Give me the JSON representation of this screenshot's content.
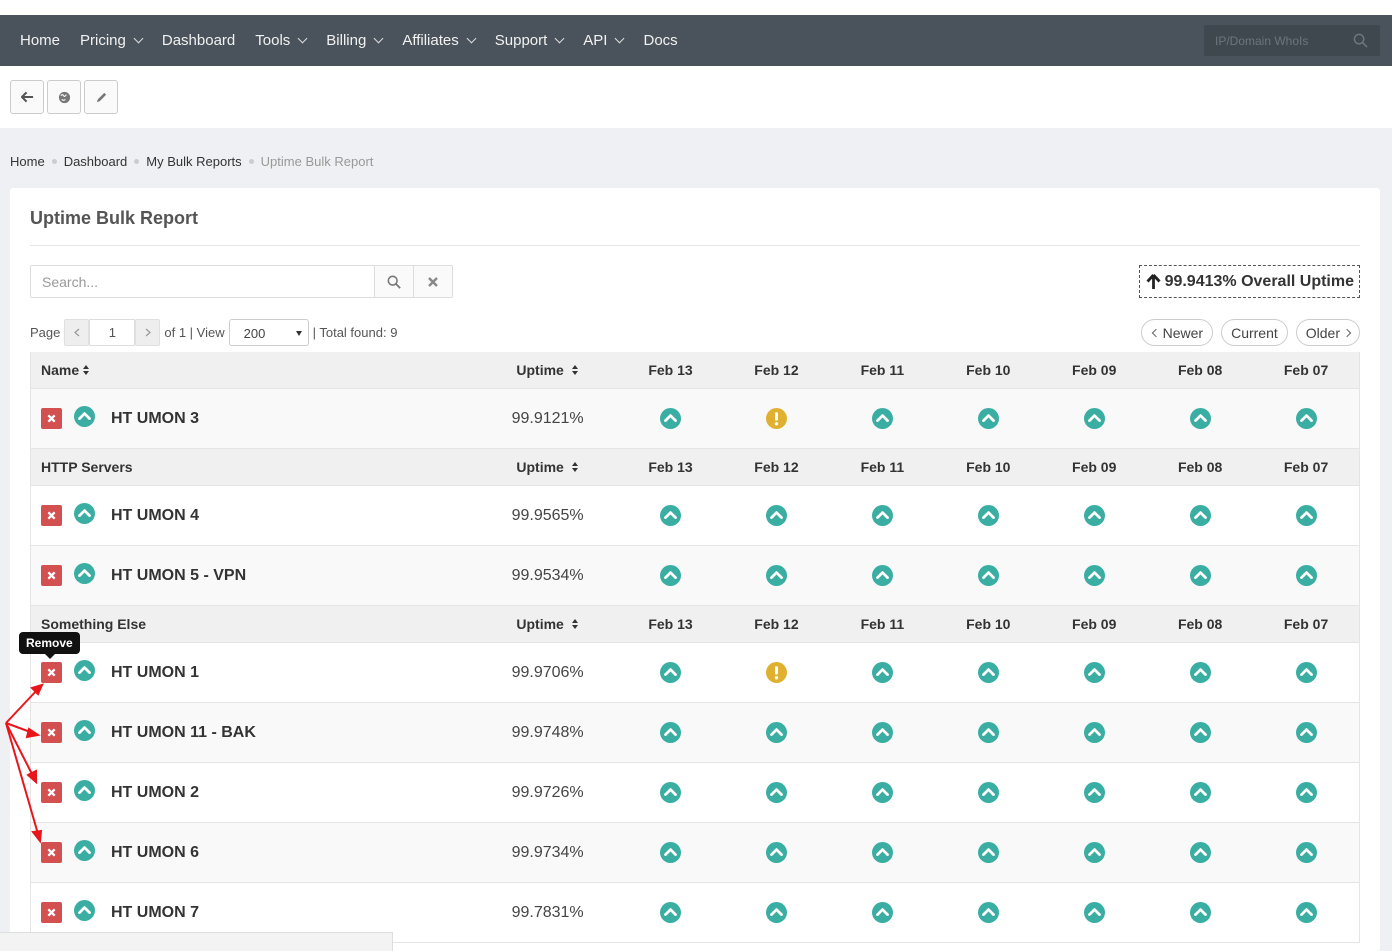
{
  "nav": {
    "items": [
      {
        "label": "Home",
        "dropdown": false
      },
      {
        "label": "Pricing",
        "dropdown": true
      },
      {
        "label": "Dashboard",
        "dropdown": false
      },
      {
        "label": "Tools",
        "dropdown": true
      },
      {
        "label": "Billing",
        "dropdown": true
      },
      {
        "label": "Affiliates",
        "dropdown": true
      },
      {
        "label": "Support",
        "dropdown": true
      },
      {
        "label": "API",
        "dropdown": true
      },
      {
        "label": "Docs",
        "dropdown": false
      }
    ],
    "search_placeholder": "IP/Domain WhoIs"
  },
  "toolbar": {
    "buttons": [
      "back-arrow-icon",
      "globe-icon",
      "pencil-icon"
    ]
  },
  "breadcrumb": {
    "items": [
      "Home",
      "Dashboard",
      "My Bulk Reports"
    ],
    "active": "Uptime Bulk Report"
  },
  "report": {
    "title": "Uptime Bulk Report",
    "search_placeholder": "Search...",
    "overall_uptime": "99.9413% Overall Uptime"
  },
  "pager": {
    "page_label": "Page",
    "page_value": "1",
    "of_text": "of 1 | View",
    "view_value": "200",
    "total_text": "| Total found: 9",
    "buttons": {
      "newer": "Newer",
      "current": "Current",
      "older": "Older"
    }
  },
  "colors": {
    "up": "#3aaea2",
    "warn": "#e0b030",
    "remove": "#d2504f",
    "nav": "#4a535c",
    "arrow": "#e8161b"
  },
  "table": {
    "uptime_label": "Uptime",
    "dates": [
      "Feb 13",
      "Feb 12",
      "Feb 11",
      "Feb 10",
      "Feb 09",
      "Feb 08",
      "Feb 07"
    ],
    "groups": [
      {
        "name": "Name",
        "monitors": [
          {
            "name": "HT UMON 3",
            "uptime": "99.9121%",
            "status": [
              "up",
              "warn",
              "up",
              "up",
              "up",
              "up",
              "up"
            ]
          }
        ]
      },
      {
        "name": "HTTP Servers",
        "monitors": [
          {
            "name": "HT UMON 4",
            "uptime": "99.9565%",
            "status": [
              "up",
              "up",
              "up",
              "up",
              "up",
              "up",
              "up"
            ]
          },
          {
            "name": "HT UMON 5 - VPN",
            "uptime": "99.9534%",
            "status": [
              "up",
              "up",
              "up",
              "up",
              "up",
              "up",
              "up"
            ]
          }
        ]
      },
      {
        "name": "Something Else",
        "monitors": [
          {
            "name": "HT UMON 1",
            "uptime": "99.9706%",
            "status": [
              "up",
              "warn",
              "up",
              "up",
              "up",
              "up",
              "up"
            ]
          },
          {
            "name": "HT UMON 11 - BAK",
            "uptime": "99.9748%",
            "status": [
              "up",
              "up",
              "up",
              "up",
              "up",
              "up",
              "up"
            ]
          },
          {
            "name": "HT UMON 2",
            "uptime": "99.9726%",
            "status": [
              "up",
              "up",
              "up",
              "up",
              "up",
              "up",
              "up"
            ]
          },
          {
            "name": "HT UMON 6",
            "uptime": "99.9734%",
            "status": [
              "up",
              "up",
              "up",
              "up",
              "up",
              "up",
              "up"
            ]
          },
          {
            "name": "HT UMON 7",
            "uptime": "99.7831%",
            "status": [
              "up",
              "up",
              "up",
              "up",
              "up",
              "up",
              "up"
            ]
          }
        ]
      }
    ]
  },
  "tooltip": "Remove"
}
